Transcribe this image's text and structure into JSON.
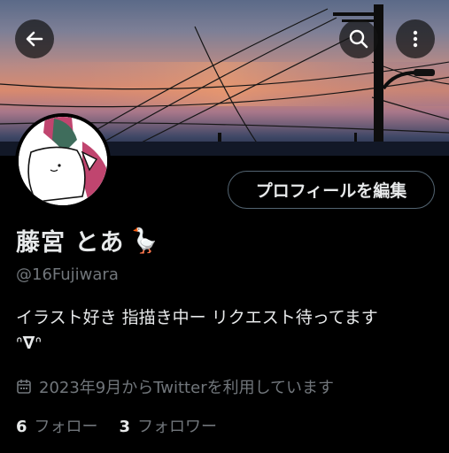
{
  "header": {
    "back_icon": "arrow-left-icon",
    "search_icon": "search-icon",
    "more_icon": "more-vertical-icon"
  },
  "profile": {
    "display_name": "藤宮 とあ",
    "name_emoji": "🪿",
    "handle": "@16Fujiwara",
    "bio_line1": "イラスト好き 指描き中ー リクエスト待ってます",
    "bio_line2": "ᐢ𝛁ᐢ",
    "joined": "2023年9月からTwitterを利用しています",
    "edit_button": "プロフィールを編集"
  },
  "stats": {
    "following_count": "6",
    "following_label": "フォロー",
    "followers_count": "3",
    "followers_label": "フォロワー"
  },
  "colors": {
    "background": "#000000",
    "text_primary": "#e7e9ea",
    "text_secondary": "#71767b",
    "border": "#536471"
  }
}
